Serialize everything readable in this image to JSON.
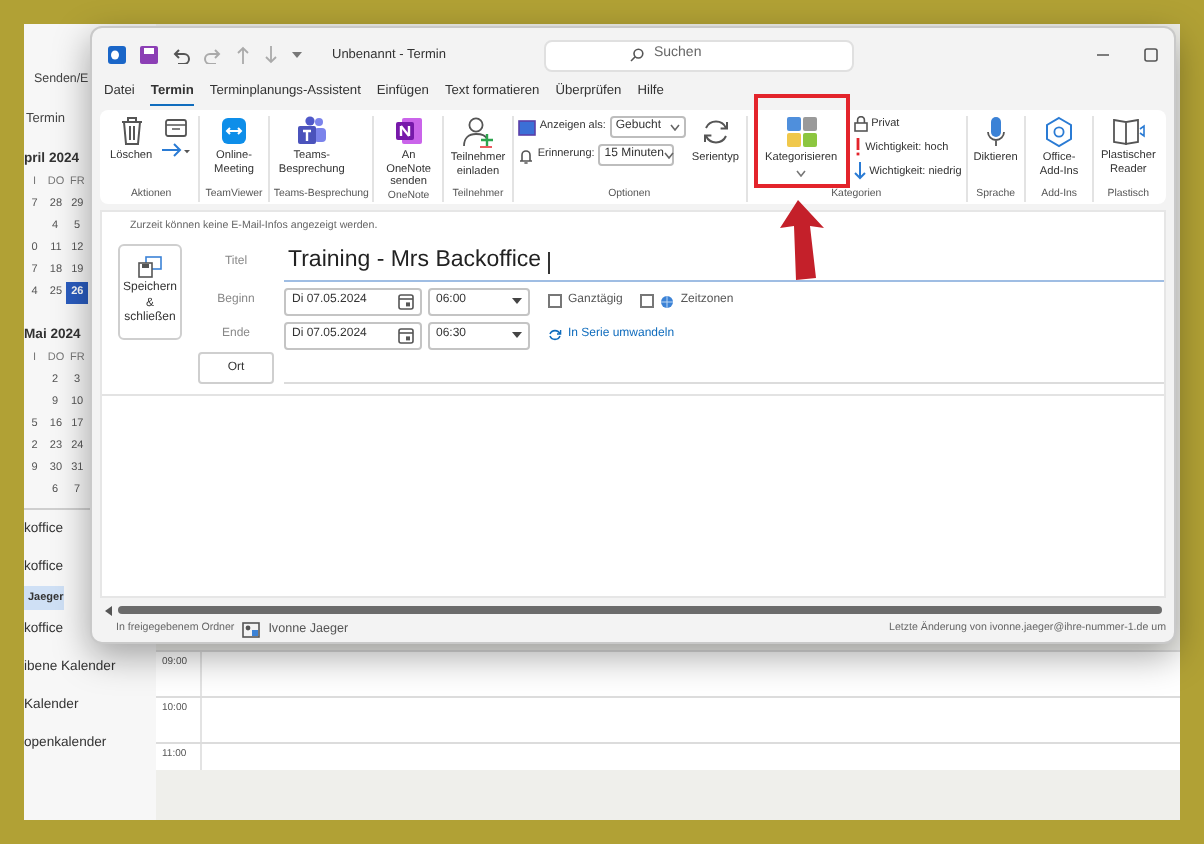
{
  "background": {
    "toolbar_label": "Senden/E",
    "nav_title": "Termin",
    "calendars": [
      {
        "month": "pril 2024",
        "weekdays": [
          "I",
          "DO",
          "FR"
        ],
        "weeks": [
          [
            {
              "day": "7",
              "selected": false
            },
            {
              "day": "28",
              "selected": false
            },
            {
              "day": "29",
              "selected": false
            }
          ],
          [
            {
              "day": "4",
              "selected": false
            },
            {
              "day": "5",
              "selected": false
            }
          ],
          [
            {
              "day": "0",
              "selected": false
            },
            {
              "day": "11",
              "selected": false
            },
            {
              "day": "12",
              "selected": false
            }
          ],
          [
            {
              "day": "7",
              "selected": false
            },
            {
              "day": "18",
              "selected": false
            },
            {
              "day": "19",
              "selected": false
            }
          ],
          [
            {
              "day": "4",
              "selected": false
            },
            {
              "day": "25",
              "selected": false
            },
            {
              "day": "26",
              "selected": true
            }
          ]
        ]
      },
      {
        "month": "Mai 2024",
        "weekdays": [
          "I",
          "DO",
          "FR"
        ],
        "weeks": [
          [
            {
              "day": "2",
              "selected": false
            },
            {
              "day": "3",
              "selected": false
            }
          ],
          [
            {
              "day": "9",
              "selected": false
            },
            {
              "day": "10",
              "selected": false
            }
          ],
          [
            {
              "day": "5",
              "selected": false
            },
            {
              "day": "16",
              "selected": false
            },
            {
              "day": "17",
              "selected": false
            }
          ],
          [
            {
              "day": "2",
              "selected": false
            },
            {
              "day": "23",
              "selected": false
            },
            {
              "day": "24",
              "selected": false
            }
          ],
          [
            {
              "day": "9",
              "selected": false
            },
            {
              "day": "30",
              "selected": false
            },
            {
              "day": "31",
              "selected": false
            }
          ],
          [
            {
              "day": "6",
              "selected": false
            },
            {
              "day": "7",
              "selected": false
            }
          ]
        ]
      }
    ],
    "folders": [
      {
        "label": "koffice",
        "selected": false
      },
      {
        "label": "koffice",
        "selected": false
      },
      {
        "label": "Jaeger",
        "selected": true
      },
      {
        "label": "koffice",
        "selected": false
      },
      {
        "label": "ibene Kalender",
        "selected": false
      },
      {
        "label": "Kalender",
        "selected": false
      },
      {
        "label": "openkalender",
        "selected": false
      }
    ],
    "time_slots": [
      "09:00",
      "10:00",
      "11:00"
    ]
  },
  "window": {
    "title": "Unbenannt - Termin",
    "search": {
      "placeholder": "Suchen"
    },
    "tabs": [
      {
        "label": "Datei",
        "selected": false
      },
      {
        "label": "Termin",
        "selected": true
      },
      {
        "label": "Terminplanungs-Assistent",
        "selected": false
      },
      {
        "label": "Einfügen",
        "selected": false
      },
      {
        "label": "Text formatieren",
        "selected": false
      },
      {
        "label": "Überprüfen",
        "selected": false
      },
      {
        "label": "Hilfe",
        "selected": false
      }
    ],
    "ribbon": [
      {
        "label": "Aktionen",
        "items": [
          {
            "kind": "large",
            "label": "Löschen"
          },
          {
            "kind": "icon_button"
          }
        ]
      },
      {
        "label": "TeamViewer",
        "items": [
          {
            "kind": "large",
            "label": "Online-Meeting"
          }
        ]
      },
      {
        "label": "Teams-Besprechung",
        "items": [
          {
            "kind": "large",
            "label": "Teams-Besprechung"
          }
        ]
      },
      {
        "label": "OneNote",
        "items": [
          {
            "kind": "large",
            "label": "An OneNote senden"
          }
        ]
      },
      {
        "label": "Teilnehmer",
        "items": [
          {
            "kind": "large",
            "label": "Teilnehmer einladen"
          }
        ]
      },
      {
        "label": "Optionen",
        "items": [
          {
            "kind": "option",
            "label": "Anzeigen als:",
            "value": "Gebucht"
          },
          {
            "kind": "option",
            "label": "Erinnerung:",
            "value": "15 Minuten"
          },
          {
            "kind": "large",
            "label": "Serientyp"
          }
        ]
      },
      {
        "label": "Kategorien",
        "items": [
          {
            "kind": "large",
            "label": "Kategorisieren"
          },
          {
            "kind": "small",
            "label": "Privat"
          },
          {
            "kind": "small",
            "label": "Wichtigkeit: hoch"
          },
          {
            "kind": "small",
            "label": "Wichtigkeit: niedrig"
          }
        ]
      },
      {
        "label": "Sprache",
        "items": [
          {
            "kind": "large",
            "label": "Diktieren"
          }
        ]
      },
      {
        "label": "Add-Ins",
        "items": [
          {
            "kind": "large",
            "label": "Office-Add-Ins"
          }
        ]
      },
      {
        "label": "Plastisch",
        "items": [
          {
            "kind": "large",
            "label": "Plastischer Reader"
          }
        ]
      }
    ],
    "form": {
      "info": "Zurzeit können keine E-Mail-Infos angezeigt werden.",
      "save_button": "Speichern & schließen",
      "title": {
        "label": "Titel",
        "value": "Training - Mrs Backoffice"
      },
      "start": {
        "label": "Beginn",
        "date": "Di 07.05.2024",
        "time": "06:00"
      },
      "end": {
        "label": "Ende",
        "date": "Di 07.05.2024",
        "time": "06:30"
      },
      "all_day": {
        "label": "Ganztägig",
        "checked": false
      },
      "time_zones": {
        "label": "Zeitzonen",
        "checked": false
      },
      "recurrence_link": "In Serie umwandeln",
      "location_button": "Ort"
    },
    "status_bar": {
      "folder_label": "In freigegebenem Ordner",
      "owner": "Ivonne Jaeger",
      "last_change": "Letzte Änderung von ivonne.jaeger@ihre-nummer-1.de um"
    }
  }
}
